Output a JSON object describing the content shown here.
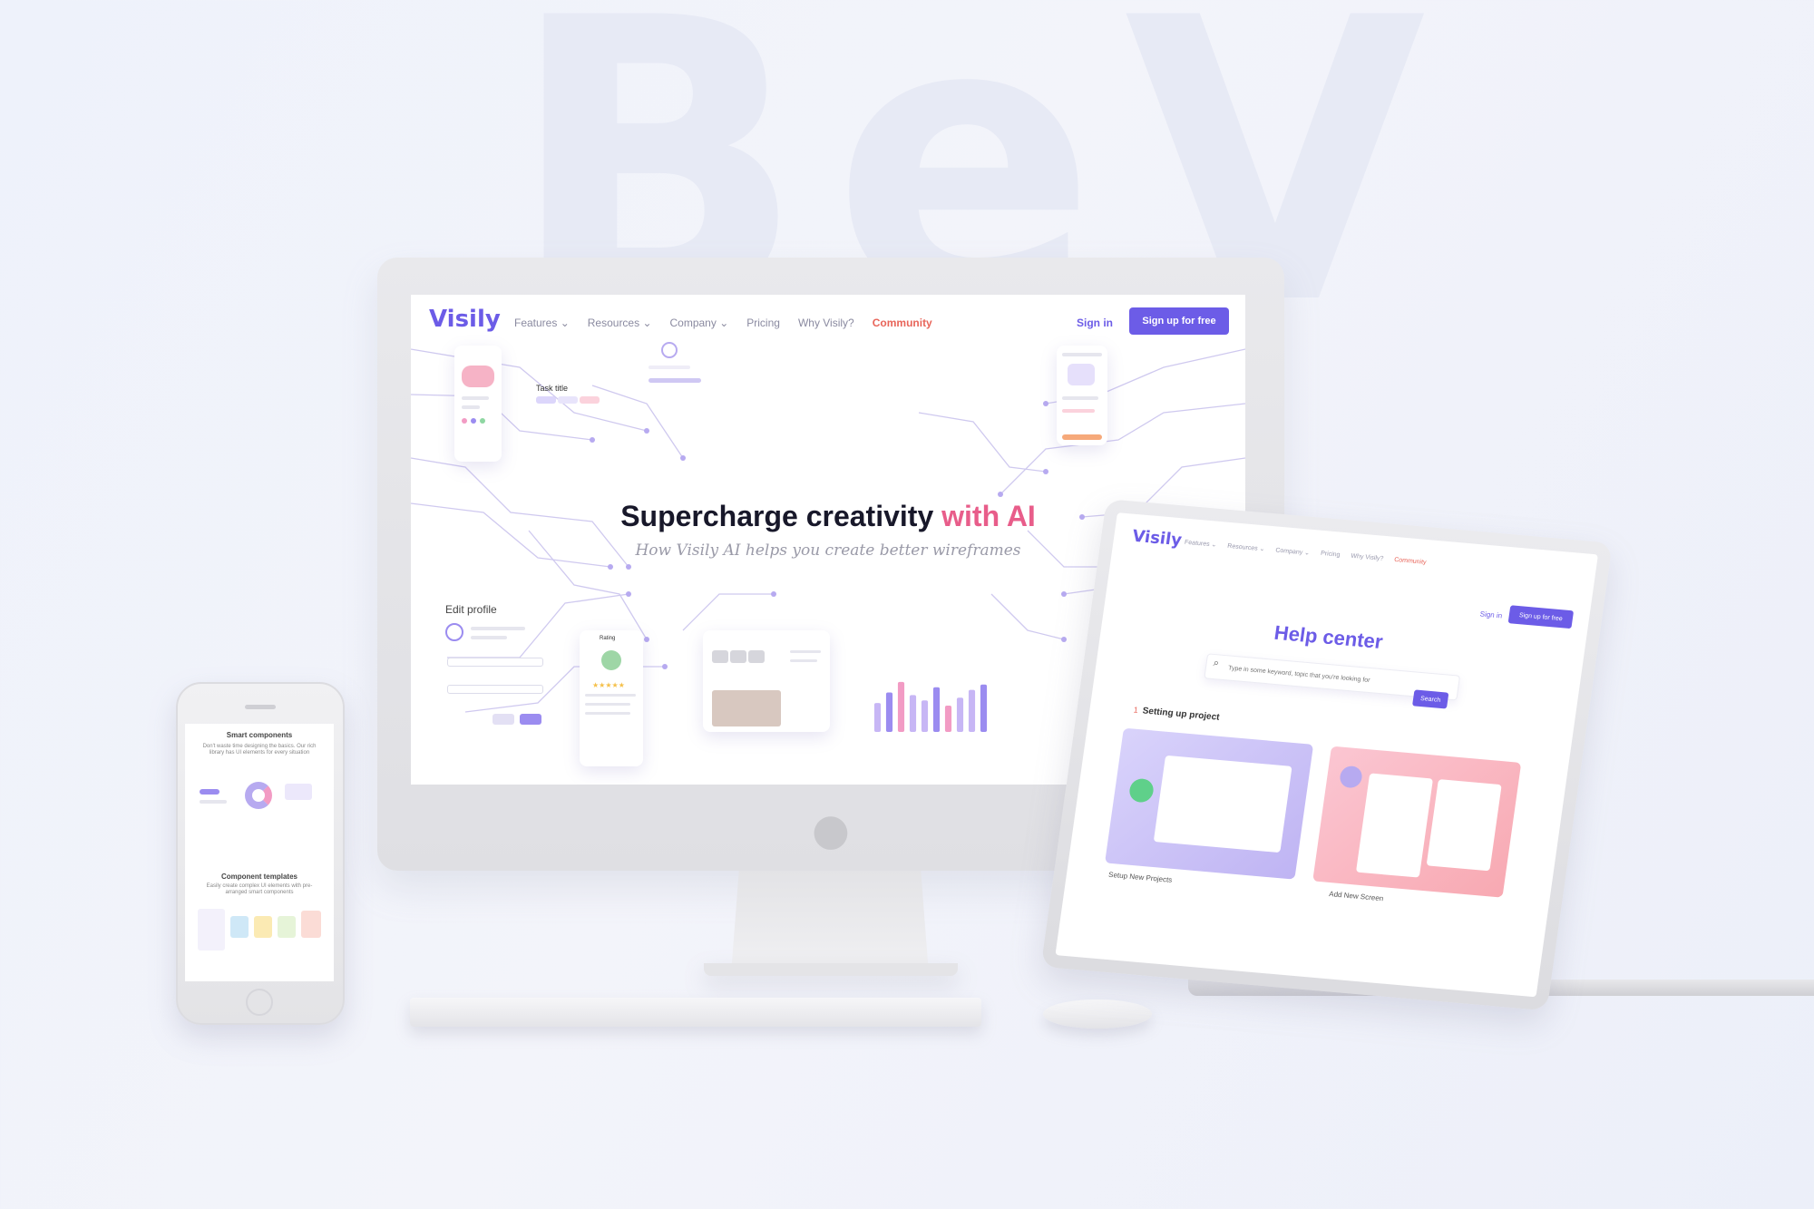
{
  "desktop": {
    "logo": "Visily",
    "nav": {
      "features": "Features ⌄",
      "resources": "Resources ⌄",
      "company": "Company ⌄",
      "pricing": "Pricing",
      "why": "Why Visily?",
      "community": "Community"
    },
    "signin": "Sign in",
    "signup": "Sign up for free",
    "hero": {
      "title_main": "Supercharge creativity ",
      "title_accent": "with AI",
      "subtitle": "How Visily AI helps you create better wireframes"
    },
    "cards": {
      "task_title": "Task title",
      "edit_profile": "Edit profile",
      "rating": "Rating"
    },
    "chart_values": [
      0.55,
      0.75,
      0.95,
      0.7,
      0.6,
      0.85,
      0.5,
      0.65,
      0.8,
      0.9
    ],
    "chart_colors": [
      "#c7b6f5",
      "#9b8cf0",
      "#f29bc4",
      "#c7b6f5"
    ]
  },
  "phone": {
    "smart_title": "Smart components",
    "smart_text": "Don't waste time designing the basics. Our rich library has UI elements for every situation",
    "templates_title": "Component templates",
    "templates_text": "Easily create complex UI elements with pre-arranged smart components"
  },
  "laptop": {
    "logo": "Visily",
    "nav": {
      "features": "Features ⌄",
      "resources": "Resources ⌄",
      "company": "Company ⌄",
      "pricing": "Pricing",
      "why": "Why Visily?",
      "community": "Community"
    },
    "signin": "Sign in",
    "signup": "Sign up for free",
    "help_title": "Help center",
    "search_placeholder": "Type in some keyword, topic that you're looking for",
    "search_button": "Search",
    "section_number": "1",
    "section_title": "Setting up project",
    "card1_label": "Setup New Projects",
    "card2_label": "Add New Screen"
  },
  "colors": {
    "brand": "#6c5ce7",
    "accent": "#e8655a"
  }
}
